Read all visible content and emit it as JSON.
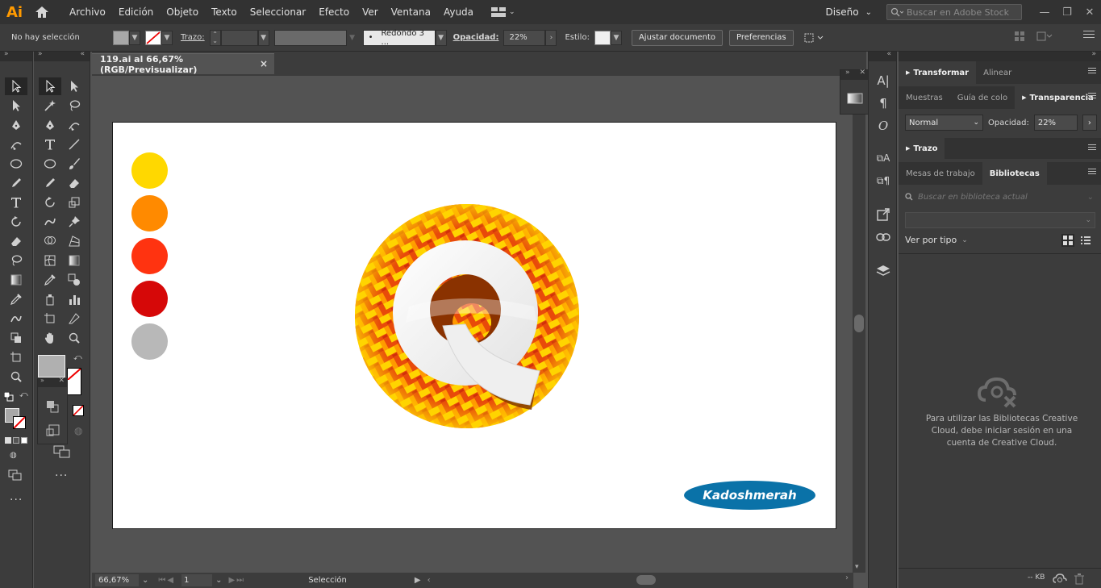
{
  "app": {
    "logo": "Ai"
  },
  "menu": [
    "Archivo",
    "Edición",
    "Objeto",
    "Texto",
    "Seleccionar",
    "Efecto",
    "Ver",
    "Ventana",
    "Ayuda"
  ],
  "workspace": {
    "label": "Diseño"
  },
  "stock_search": {
    "placeholder": "Buscar en Adobe Stock"
  },
  "control": {
    "selection": "No hay selección",
    "stroke_label": "Trazo:",
    "brush": "Redondo 3 ...",
    "opacity_label": "Opacidad:",
    "opacity_value": "22%",
    "style_label": "Estilo:",
    "doc_setup_btn": "Ajustar documento",
    "prefs_btn": "Preferencias"
  },
  "document": {
    "tab_title": "119.ai al 66,67% (RGB/Previsualizar)",
    "close": "×"
  },
  "artwork": {
    "swatches": [
      "#ffd800",
      "#ff8a00",
      "#ff3310",
      "#d60808",
      "#b8b8b8"
    ],
    "brand_text": "Kadoshmerah",
    "brand_color": "#0a72a8"
  },
  "status": {
    "zoom": "66,67%",
    "page": "1",
    "mode": "Selección"
  },
  "panels": {
    "transform_tabs": [
      "Transformar",
      "Alinear"
    ],
    "transparency_tabs": [
      "Muestras",
      "Guía de colo",
      "Transparencia"
    ],
    "blend_mode": "Normal",
    "opacity_label": "Opacidad:",
    "opacity_value": "22%",
    "stroke_tab": "Trazo",
    "library_tabs": [
      "Mesas de trabajo",
      "Bibliotecas"
    ],
    "library_search_placeholder": "Buscar en biblioteca actual",
    "view_by": "Ver por tipo",
    "cc_message": "Para utilizar las Bibliotecas Creative Cloud, debe iniciar sesión en una cuenta de Creative Cloud.",
    "kb": "-- KB"
  },
  "colors": {
    "ui_dark": "#323232",
    "ui_panel": "#3c3c3c",
    "canvas": "#535353",
    "accent": "#ff9a00"
  }
}
